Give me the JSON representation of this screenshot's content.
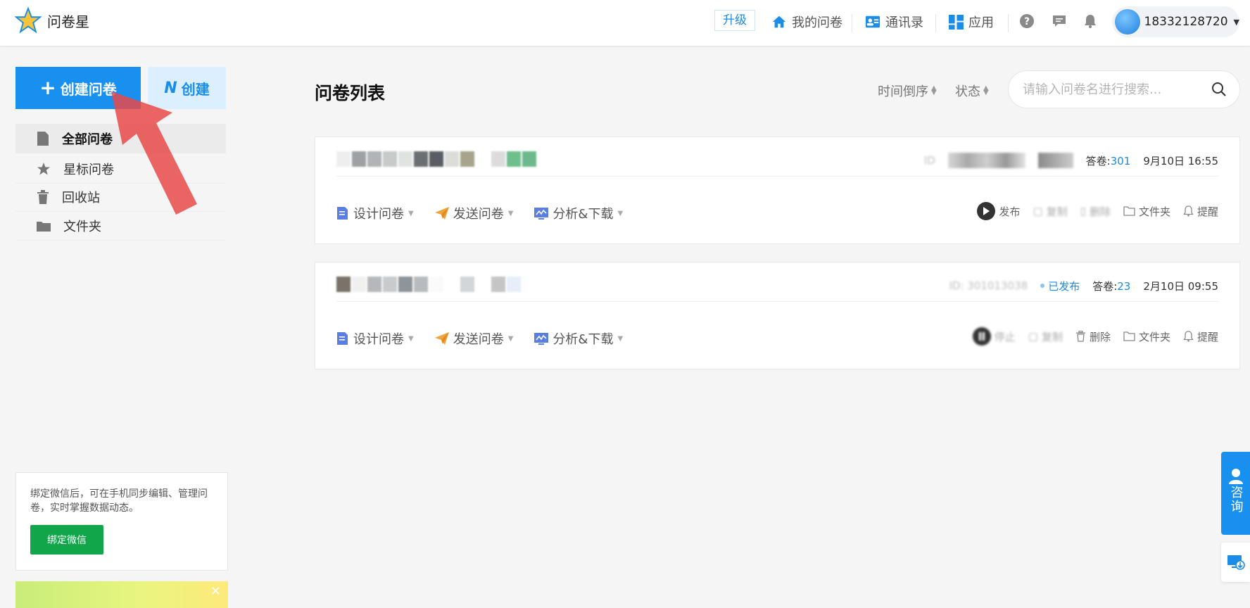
{
  "header": {
    "brand": "问卷星",
    "upgrade": "升级",
    "nav": [
      {
        "label": "我的问卷",
        "icon": "home-icon"
      },
      {
        "label": "通讯录",
        "icon": "contact-card-icon"
      },
      {
        "label": "应用",
        "icon": "apps-grid-icon"
      }
    ],
    "user": "18332128720",
    "colors": {
      "accent": "#1890f0"
    }
  },
  "sidebar": {
    "create_label": "创建问卷",
    "ai_create_label": "创建",
    "items": [
      {
        "label": "全部问卷",
        "icon": "document-icon"
      },
      {
        "label": "星标问卷",
        "icon": "star-icon"
      },
      {
        "label": "回收站",
        "icon": "trash-icon"
      },
      {
        "label": "文件夹",
        "icon": "folder-icon"
      }
    ],
    "wechat_text": "绑定微信后，可在手机同步编辑、管理问卷，实时掌握数据动态。",
    "wechat_button": "绑定微信"
  },
  "main": {
    "title": "问卷列表",
    "sort_time": "时间倒序",
    "sort_status": "状态",
    "search_placeholder": "请输入问卷名进行搜索...",
    "actions": {
      "design": "设计问卷",
      "send": "发送问卷",
      "analyze": "分析&下载"
    },
    "surveys": [
      {
        "id_text": "ID",
        "status": "",
        "answers_label": "答卷:",
        "answers": "301",
        "datetime": "9月10日 16:55",
        "tools": {
          "publish": "发布",
          "copy": "复制",
          "delete": "删除",
          "folder": "文件夹",
          "remind": "提醒"
        }
      },
      {
        "id_text": "ID: 301013038",
        "status": "已发布",
        "answers_label": "答卷:",
        "answers": "23",
        "datetime": "2月10日 09:55",
        "tools": {
          "publish": "停止",
          "copy": "复制",
          "delete": "删除",
          "folder": "文件夹",
          "remind": "提醒"
        }
      }
    ]
  },
  "float": {
    "consult": "咨询"
  }
}
